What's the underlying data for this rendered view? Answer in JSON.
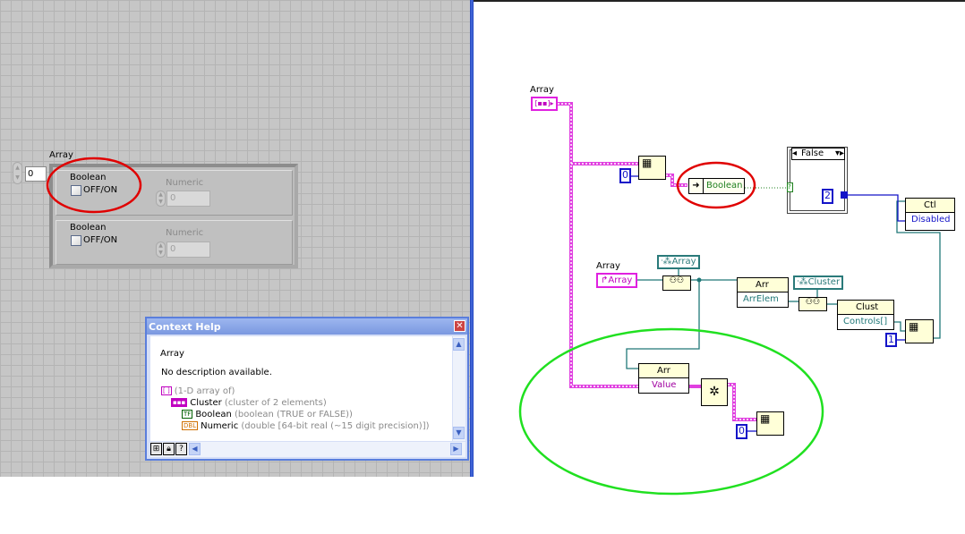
{
  "front_panel": {
    "array_label": "Array",
    "index_value": "0",
    "elements": [
      {
        "boolean_label": "Boolean",
        "boolean_text": "OFF/ON",
        "numeric_label": "Numeric",
        "numeric_value": "0"
      },
      {
        "boolean_label": "Boolean",
        "boolean_text": "OFF/ON",
        "numeric_label": "Numeric",
        "numeric_value": "0"
      }
    ]
  },
  "context_help": {
    "title": "Context Help",
    "close": "✕",
    "heading": "Array",
    "description": "No description available.",
    "tree": [
      {
        "tag": "[ ]",
        "name": "",
        "type": "(1-D array of)",
        "color": "#c000c0"
      },
      {
        "tag": "▪▪▪",
        "name": "Cluster",
        "type": "(cluster of 2 elements)",
        "color": "#c000c0"
      },
      {
        "tag": "TF",
        "name": "Boolean",
        "type": "(boolean (TRUE or FALSE))",
        "color": "#006000"
      },
      {
        "tag": "DBL",
        "name": "Numeric",
        "type": "(double [64-bit real (~15 digit precision)])",
        "color": "#d07000"
      }
    ]
  },
  "block_diagram": {
    "array_terminal_label": "Array",
    "index_const_0": "0",
    "boolean_local": "Boolean",
    "case_selector": "False",
    "case_const": "2",
    "ctl_node": {
      "class": "Ctl",
      "property": "Disabled"
    },
    "ref_label": "Array",
    "ref_name": "Array",
    "class_array": "Array",
    "arr_node": {
      "class": "Arr",
      "property": "ArrElem"
    },
    "class_cluster": "Cluster",
    "clust_node": {
      "class": "Clust",
      "property": "Controls[]"
    },
    "index_const_1": "1",
    "arr_value_node": {
      "class": "Arr",
      "property": "Value"
    },
    "index_const_0b": "0"
  },
  "colors": {
    "cluster_wire": "#e040e0",
    "ref_wire": "#207878",
    "numeric_wire": "#1414c8",
    "highlight_red": "#e00000",
    "highlight_green": "#20e020"
  }
}
